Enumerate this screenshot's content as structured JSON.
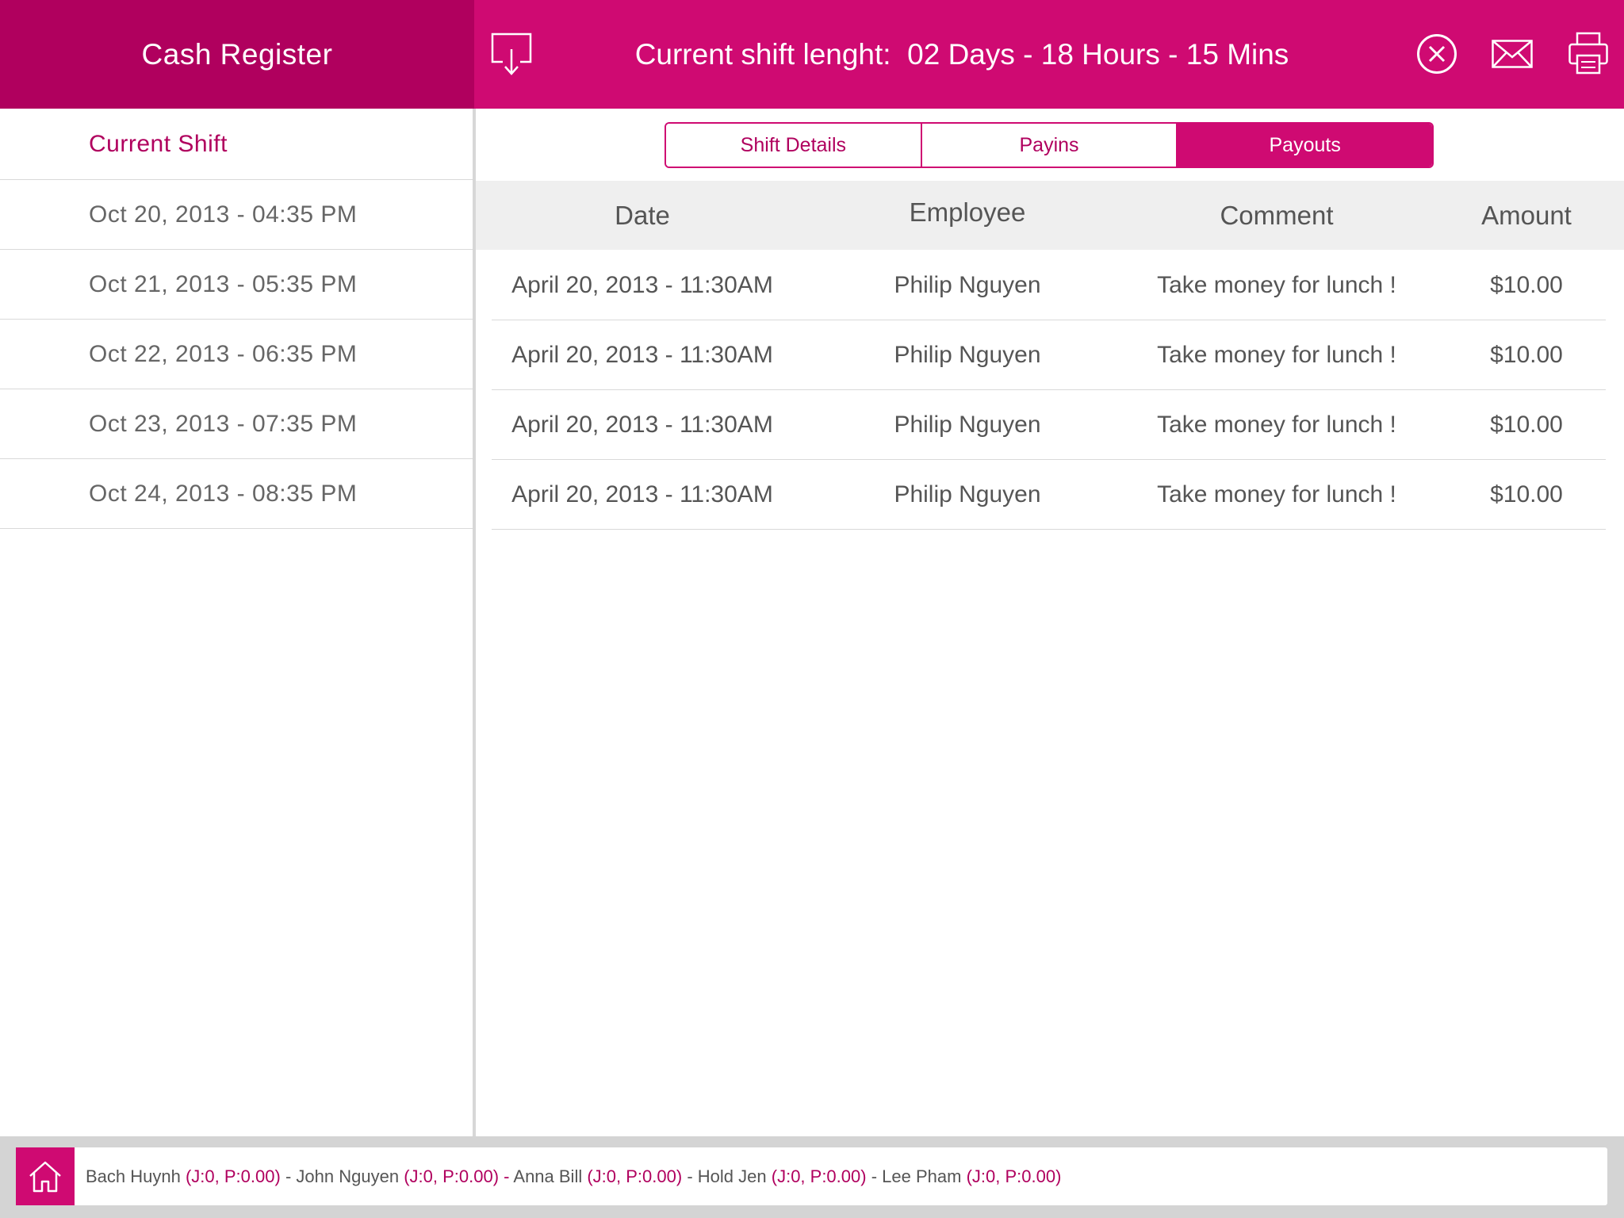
{
  "app": {
    "title": "Cash Register",
    "shift_length": "Current shift lenght:  02 Days - 18 Hours - 15 Mins"
  },
  "icons": {
    "export": "export-icon",
    "close": "close-circle-icon",
    "mail": "mail-icon",
    "print": "printer-icon",
    "home": "home-icon"
  },
  "colors": {
    "brand_dark": "#b0005e",
    "brand": "#cf0a72",
    "header_bg": "#efefef",
    "footer_bg": "#d4d4d4"
  },
  "sidebar": {
    "items": [
      {
        "label": "Current Shift",
        "active": true
      },
      {
        "label": "Oct 20, 2013 - 04:35 PM",
        "active": false
      },
      {
        "label": "Oct 21, 2013 - 05:35 PM",
        "active": false
      },
      {
        "label": "Oct 22, 2013 - 06:35 PM",
        "active": false
      },
      {
        "label": "Oct 23, 2013 - 07:35 PM",
        "active": false
      },
      {
        "label": "Oct 24, 2013 - 08:35 PM",
        "active": false
      }
    ]
  },
  "tabs": [
    {
      "label": "Shift Details",
      "active": false
    },
    {
      "label": "Payins",
      "active": false
    },
    {
      "label": "Payouts",
      "active": true
    }
  ],
  "table": {
    "columns": [
      "Date",
      "Employee",
      "Comment",
      "Amount"
    ],
    "rows": [
      {
        "date": "April 20, 2013 - 11:30AM",
        "employee": "Philip Nguyen",
        "comment": "Take money for lunch !",
        "amount": "$10.00"
      },
      {
        "date": "April 20, 2013 - 11:30AM",
        "employee": "Philip Nguyen",
        "comment": "Take money for lunch !",
        "amount": "$10.00"
      },
      {
        "date": "April 20, 2013 - 11:30AM",
        "employee": "Philip Nguyen",
        "comment": "Take money for lunch !",
        "amount": "$10.00"
      },
      {
        "date": "April 20, 2013 - 11:30AM",
        "employee": "Philip Nguyen",
        "comment": "Take money for lunch !",
        "amount": "$10.00"
      }
    ]
  },
  "footer": {
    "staff": [
      {
        "name": "Bach Huynh",
        "stats": "(J:0, P:0.00)"
      },
      {
        "name": "John Nguyen",
        "stats": "(J:0, P:0.00)"
      },
      {
        "name": "Anna Bill",
        "stats": "(J:0, P:0.00)"
      },
      {
        "name": "Hold Jen",
        "stats": "(J:0, P:0.00)"
      },
      {
        "name": "Lee Pham",
        "stats": "(J:0, P:0.00)"
      }
    ],
    "separator": " - "
  }
}
